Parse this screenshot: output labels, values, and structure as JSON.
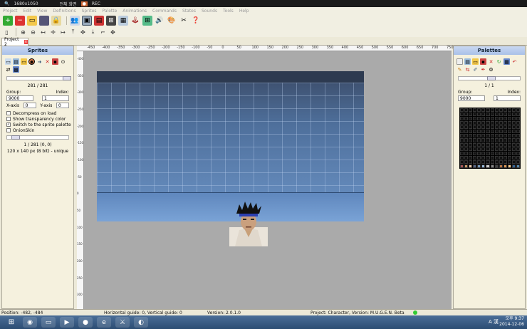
{
  "recorder": {
    "resolution": "1680x1050",
    "mode": "전체 화면",
    "rec": "REC"
  },
  "menu": [
    "Project",
    "Edit",
    "View",
    "Definitions",
    "Sprites",
    "Palette",
    "Animations",
    "Commands",
    "States",
    "Sounds",
    "Tools",
    "Help"
  ],
  "tabs": [
    {
      "label": "Project 2"
    }
  ],
  "sprites_panel": {
    "title": "Sprites",
    "counter": "281 / 281",
    "group_label": "Group:",
    "index_label": "Index:",
    "group_value": "9000",
    "index_value": "1",
    "xaxis_label": "X-axis",
    "xaxis_value": "0",
    "yaxis_label": "Y-axis",
    "yaxis_value": "0",
    "checkboxes": [
      {
        "label": "Decompress on load",
        "checked": false
      },
      {
        "label": "Show transparency color",
        "checked": false
      },
      {
        "label": "Switch to the sprite palette",
        "checked": true
      },
      {
        "label": "OnionSkin",
        "checked": false
      }
    ],
    "info_line1": "1 / 281 (0, 0)",
    "info_line2": "120 x 140 px (8 bit) - unique"
  },
  "palettes_panel": {
    "title": "Palettes",
    "counter": "1 / 1",
    "group_label": "Group:",
    "index_label": "Index:",
    "group_value": "9000",
    "index_value": "1"
  },
  "ruler": {
    "top_ticks": [
      "-450",
      "-400",
      "-350",
      "-300",
      "-250",
      "-200",
      "-150",
      "-100",
      "-50",
      "0",
      "50",
      "100",
      "150",
      "200",
      "250",
      "300",
      "350",
      "400",
      "450",
      "500",
      "550",
      "600",
      "650",
      "700",
      "750"
    ],
    "left_ticks": [
      "-400",
      "-350",
      "-300",
      "-250",
      "-200",
      "-150",
      "-100",
      "-50",
      "0",
      "50",
      "100",
      "150",
      "200",
      "250",
      "300"
    ]
  },
  "status": {
    "position": "Position: -482, -484",
    "guides": "Horizontal guide: 0, Vertical guide: 0",
    "version": "Version: 2.0.1.0",
    "project": "Project: Character, Version: M.U.G.E.N. Beta"
  },
  "taskbar": {
    "time": "오후 9:37",
    "date": "2014-12-06",
    "ime": "A 漢"
  },
  "colors": {
    "accent": "#a9c0e8",
    "canvas": "#aaaaaa"
  }
}
